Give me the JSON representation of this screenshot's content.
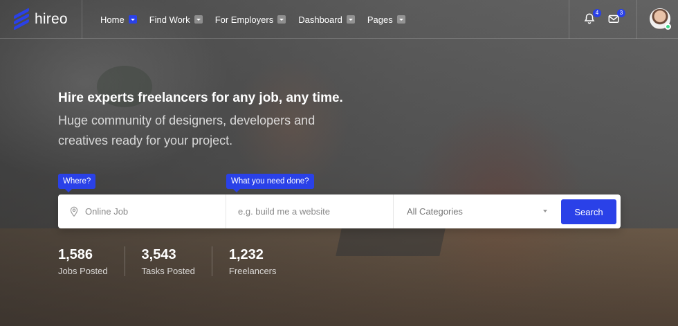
{
  "brand": {
    "name": "hireo",
    "accent": "#2a41e8"
  },
  "nav": {
    "items": [
      {
        "label": "Home",
        "active": true
      },
      {
        "label": "Find Work",
        "active": false
      },
      {
        "label": "For Employers",
        "active": false
      },
      {
        "label": "Dashboard",
        "active": false
      },
      {
        "label": "Pages",
        "active": false
      }
    ]
  },
  "header": {
    "notifications": {
      "icon": "bell-icon",
      "count": "4"
    },
    "messages": {
      "icon": "envelope-icon",
      "count": "3"
    },
    "avatar": {
      "status": "online"
    }
  },
  "hero": {
    "headline": "Hire experts freelancers for any job, any time.",
    "subline": "Huge community of designers, developers and creatives ready for your project."
  },
  "search": {
    "where_tip": "Where?",
    "what_tip": "What you need done?",
    "location_placeholder": "Online Job",
    "keyword_placeholder": "e.g. build me a website",
    "category_value": "All Categories",
    "button_label": "Search"
  },
  "stats": [
    {
      "value": "1,586",
      "label": "Jobs Posted"
    },
    {
      "value": "3,543",
      "label": "Tasks Posted"
    },
    {
      "value": "1,232",
      "label": "Freelancers"
    }
  ]
}
